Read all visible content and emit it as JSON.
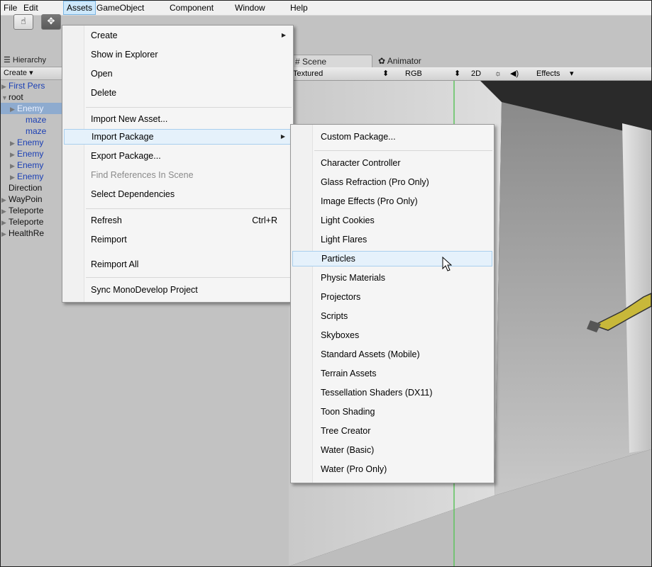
{
  "menubar": {
    "items": [
      "File",
      "Edit",
      "Assets",
      "GameObject",
      "Component",
      "Window",
      "Help"
    ]
  },
  "hierarchy": {
    "tab_label": "Hierarchy",
    "create_label": "Create",
    "rows": [
      {
        "label": "First Pers",
        "indent": 0,
        "expander": "▶",
        "color": "blue"
      },
      {
        "label": "root",
        "indent": 0,
        "expander": "▼",
        "color": "normal"
      },
      {
        "label": "Enemy",
        "indent": 1,
        "expander": "▶",
        "color": "selected"
      },
      {
        "label": "maze",
        "indent": 2,
        "expander": "",
        "color": "blue"
      },
      {
        "label": "maze",
        "indent": 2,
        "expander": "",
        "color": "blue"
      },
      {
        "label": "Enemy",
        "indent": 1,
        "expander": "▶",
        "color": "blue"
      },
      {
        "label": "Enemy",
        "indent": 1,
        "expander": "▶",
        "color": "blue"
      },
      {
        "label": "Enemy",
        "indent": 1,
        "expander": "▶",
        "color": "blue"
      },
      {
        "label": "Enemy",
        "indent": 1,
        "expander": "▶",
        "color": "blue"
      },
      {
        "label": "Direction",
        "indent": 0,
        "expander": "",
        "color": "normal"
      },
      {
        "label": "WayPoin",
        "indent": 0,
        "expander": "▶",
        "color": "normal"
      },
      {
        "label": "Teleporte",
        "indent": 0,
        "expander": "▶",
        "color": "normal"
      },
      {
        "label": "Teleporte",
        "indent": 0,
        "expander": "▶",
        "color": "normal"
      },
      {
        "label": "HealthRe",
        "indent": 0,
        "expander": "▶",
        "color": "normal"
      }
    ]
  },
  "scene": {
    "tab_scene": "Scene",
    "tab_animator": "Animator",
    "shading": "Textured",
    "render_mode": "RGB",
    "toggle_2d": "2D",
    "effects": "Effects"
  },
  "assets_menu": {
    "items": [
      {
        "label": "Create",
        "submenu": true
      },
      {
        "label": "Show in Explorer"
      },
      {
        "label": "Open"
      },
      {
        "label": "Delete"
      },
      {
        "label": "Import New Asset..."
      },
      {
        "label": "Import Package",
        "submenu": true,
        "hover": true
      },
      {
        "label": "Export Package..."
      },
      {
        "label": "Find References In Scene",
        "disabled": true
      },
      {
        "label": "Select Dependencies"
      },
      {
        "label": "Refresh",
        "shortcut": "Ctrl+R"
      },
      {
        "label": "Reimport"
      },
      {
        "label": "Reimport All"
      },
      {
        "label": "Sync MonoDevelop Project"
      }
    ]
  },
  "import_package_menu": {
    "items": [
      {
        "label": "Custom Package..."
      },
      {
        "label": "Character Controller"
      },
      {
        "label": "Glass Refraction (Pro Only)"
      },
      {
        "label": "Image Effects (Pro Only)"
      },
      {
        "label": "Light Cookies"
      },
      {
        "label": "Light Flares"
      },
      {
        "label": "Particles",
        "hover": true
      },
      {
        "label": "Physic Materials"
      },
      {
        "label": "Projectors"
      },
      {
        "label": "Scripts"
      },
      {
        "label": "Skyboxes"
      },
      {
        "label": "Standard Assets (Mobile)"
      },
      {
        "label": "Terrain Assets"
      },
      {
        "label": "Tessellation Shaders (DX11)"
      },
      {
        "label": "Toon Shading"
      },
      {
        "label": "Tree Creator"
      },
      {
        "label": "Water (Basic)"
      },
      {
        "label": "Water (Pro Only)"
      }
    ]
  },
  "colors": {
    "menu_hover": "#e5f1fb",
    "menubar_open": "#cde8fb",
    "selection_blue": "#8eabcf",
    "hierarchy_text_blue": "#1a3fb5"
  }
}
